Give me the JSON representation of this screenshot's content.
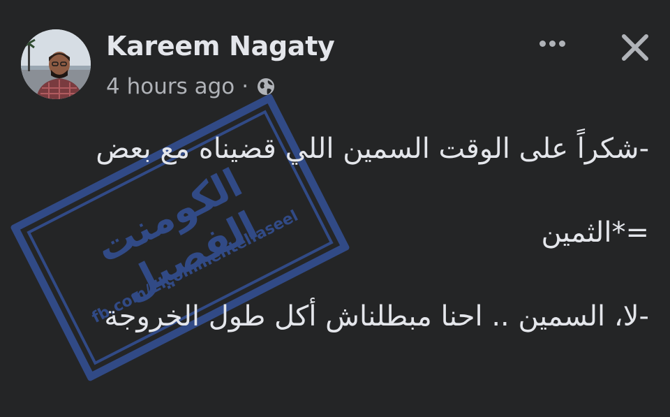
{
  "post": {
    "author": "Kareem Nagaty",
    "timestamp": "4 hours ago",
    "separator": "·",
    "privacy_icon": "globe-icon",
    "more_icon": "more-dots-icon",
    "close_icon": "close-icon",
    "lines": [
      "-شكراً على الوقت السمين اللي قضيناه مع بعض",
      "=*الثمين",
      "-لا، السمين .. احنا مبطلناش أكل طول الخروجة"
    ]
  },
  "watermark": {
    "title": "الكومنت الفصيل",
    "url": "fb.com/Elcommentelfaseel",
    "color": "#3a62c2"
  },
  "colors": {
    "background": "#242526",
    "primary_text": "#e4e6eb",
    "secondary_text": "#b0b3b8"
  }
}
